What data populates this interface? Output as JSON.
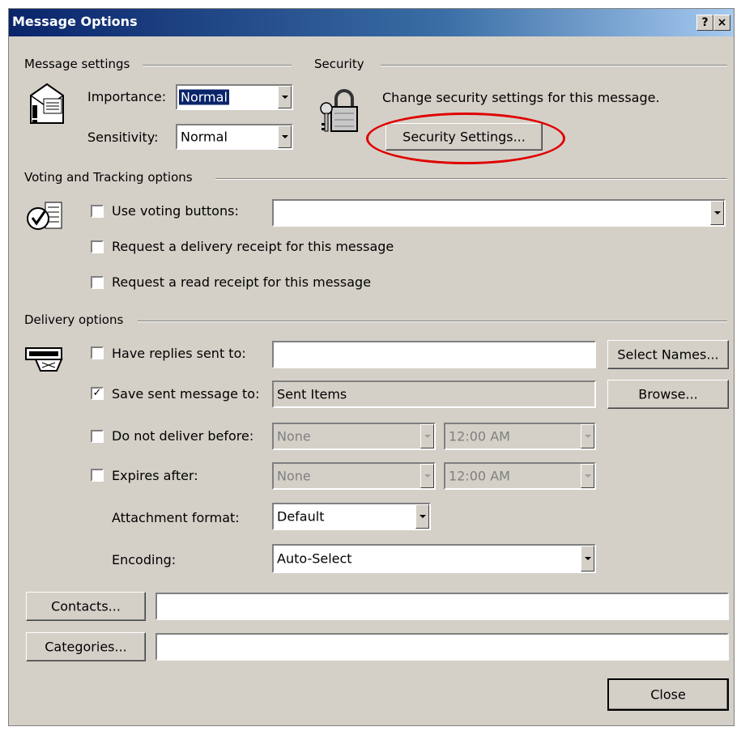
{
  "window": {
    "title": "Message Options",
    "help_btn": "?",
    "close_btn": "×"
  },
  "message_settings": {
    "heading": "Message settings",
    "importance_label": "Importance:",
    "importance_value": "Normal",
    "sensitivity_label": "Sensitivity:",
    "sensitivity_value": "Normal"
  },
  "security": {
    "heading": "Security",
    "description": "Change security settings for this message.",
    "button": "Security Settings..."
  },
  "voting": {
    "heading": "Voting and Tracking options",
    "use_voting_label": "Use voting buttons:",
    "use_voting_checked": false,
    "delivery_receipt_label": "Request a delivery receipt for this message",
    "read_receipt_label": "Request a read receipt for this message"
  },
  "delivery": {
    "heading": "Delivery options",
    "have_replies_label": "Have replies sent to:",
    "select_names_button": "Select Names...",
    "save_sent_label": "Save sent message to:",
    "save_sent_checked": true,
    "save_sent_value": "Sent Items",
    "browse_button": "Browse...",
    "do_not_deliver_label": "Do not deliver before:",
    "do_not_deliver_date": "None",
    "do_not_deliver_time": "12:00 AM",
    "expires_label": "Expires after:",
    "expires_date": "None",
    "expires_time": "12:00 AM",
    "attachment_label": "Attachment format:",
    "attachment_value": "Default",
    "encoding_label": "Encoding:",
    "encoding_value": "Auto-Select"
  },
  "bottom": {
    "contacts_button": "Contacts...",
    "categories_button": "Categories...",
    "close_button": "Close"
  },
  "colors": {
    "title_bar": "#0a246a",
    "dialog_face": "#d4d0c8",
    "highlight_ellipse": "#e00000"
  }
}
